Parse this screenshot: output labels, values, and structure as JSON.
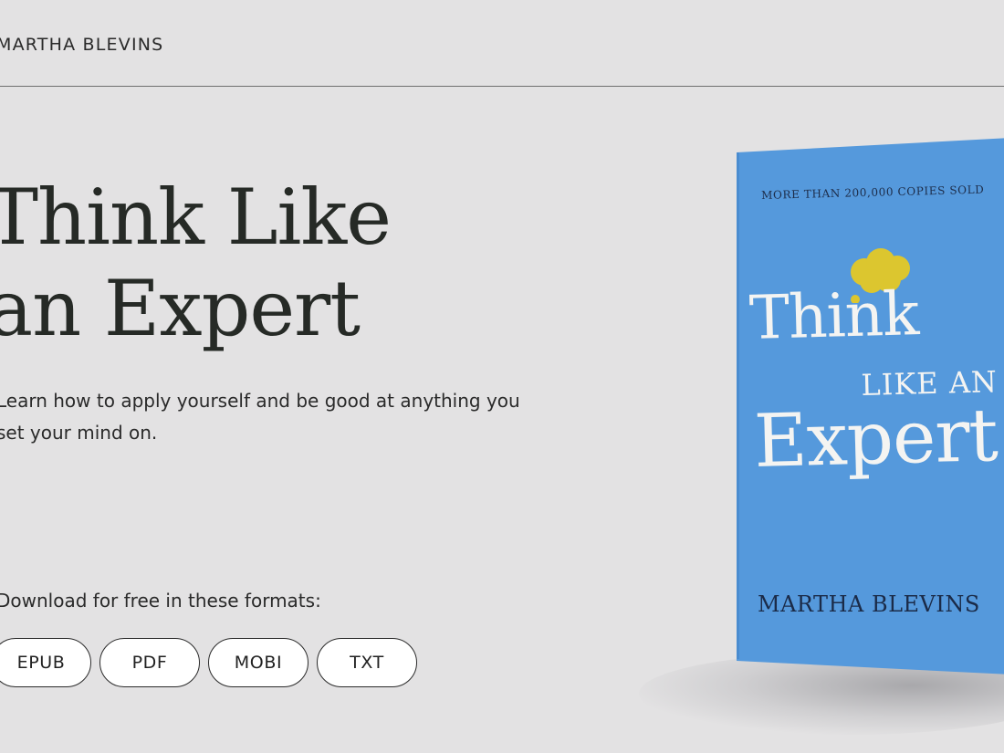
{
  "header": {
    "author_name": "MARTHA BLEVINS"
  },
  "hero": {
    "title_line1": "Think Like",
    "title_line2": "an Expert",
    "subtitle": "Learn how to apply yourself and be good at anything you set your mind on."
  },
  "download": {
    "label": "Download for free in these formats:",
    "formats": [
      "EPUB",
      "PDF",
      "MOBI",
      "TXT"
    ]
  },
  "book_cover": {
    "tagline": "MORE THAN 200,000 COPIES SOLD",
    "title_think": "Think",
    "title_like": "LIKE AN",
    "title_expert": "Expert",
    "author": "MARTHA BLEVINS",
    "cover_color": "#5599dc",
    "cloud_color": "#dcc62f",
    "icon": "thought-cloud-icon"
  }
}
